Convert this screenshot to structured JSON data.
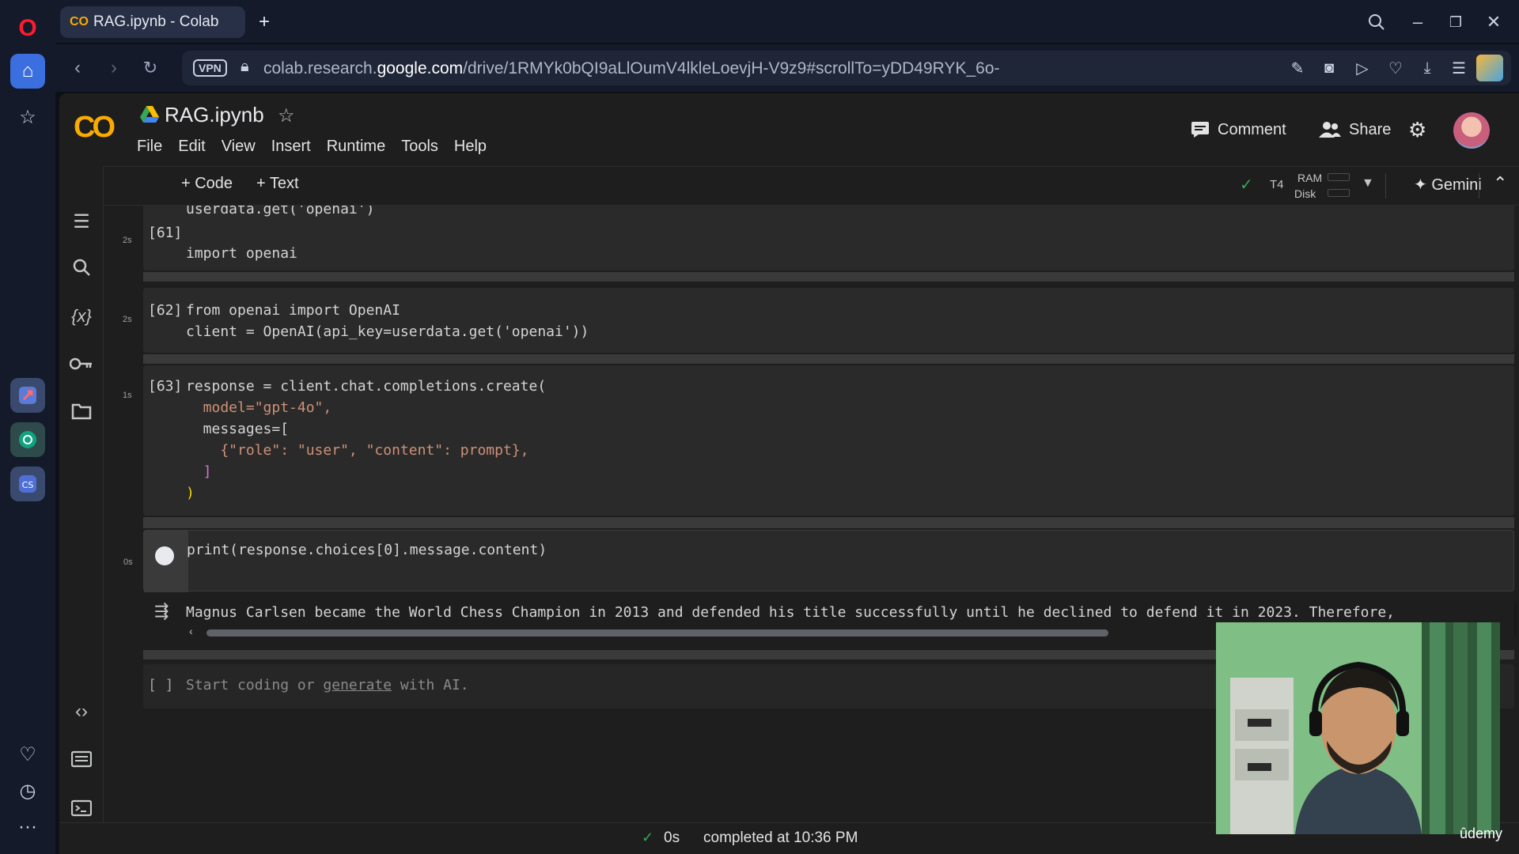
{
  "browser": {
    "tab_title": "RAG.ipynb - Colab",
    "tab_logo": "CO",
    "new_tab": "+",
    "vpn_label": "VPN",
    "url_prefix": "colab.research.",
    "url_host": "google.com",
    "url_path": "/drive/1RMYk0bQI9aLlOumV4lkleLoevjH-V9z9#scrollTo=yDD49RYK_6o-"
  },
  "colab": {
    "logo": "CO",
    "notebook_title": "RAG.ipynb",
    "menu": [
      "File",
      "Edit",
      "View",
      "Insert",
      "Runtime",
      "Tools",
      "Help"
    ],
    "comment_label": "Comment",
    "share_label": "Share",
    "add_code_label": "+ Code",
    "add_text_label": "+ Text",
    "runtime_type": "T4",
    "ram_label": "RAM",
    "disk_label": "Disk",
    "gemini_label": "Gemini"
  },
  "cells": [
    {
      "number": "[61]",
      "time": "2s",
      "lines": [
        "userdata.get('openai')",
        "import openai"
      ]
    },
    {
      "number": "[62]",
      "time": "2s",
      "lines": [
        "from openai import OpenAI",
        "client = OpenAI(api_key=userdata.get('openai'))"
      ]
    },
    {
      "number": "[63]",
      "time": "1s",
      "lines": [
        "response = client.chat.completions.create(",
        "  model=\"gpt-4o\",",
        "  messages=[",
        "    {\"role\": \"user\", \"content\": prompt},",
        "  ]",
        ")"
      ]
    },
    {
      "number": "",
      "time": "0s",
      "lines": [
        "print(response.choices[0].message.content)"
      ]
    }
  ],
  "output_text": "Magnus Carlsen became the World Chess Champion in 2013 and defended his title successfully until he declined to defend it in 2023. Therefore,",
  "empty_cell": {
    "brackets": "[ ]",
    "prefix": "Start coding or ",
    "link": "generate",
    "suffix": " with AI."
  },
  "status": {
    "elapsed": "0s",
    "message": "completed at 10:36 PM"
  },
  "watermark": "ûdemy",
  "icons": {
    "opera_sidebar": [
      "opera-logo-icon",
      "home-icon",
      "star-icon",
      "app-icon",
      "chatgpt-icon",
      "app-icon",
      "heart-icon",
      "history-icon",
      "more-icon"
    ],
    "left_panel": [
      "toc-icon",
      "search-icon",
      "variables-icon",
      "key-icon",
      "folder-icon",
      "code-snippets-icon",
      "command-palette-icon",
      "terminal-icon"
    ],
    "cell_toolbar": [
      "arrow-up-icon",
      "arrow-down-icon",
      "link-icon",
      "comment-icon",
      "gear-icon",
      "mirror-icon",
      "trash-icon",
      "more-vert-icon"
    ]
  }
}
